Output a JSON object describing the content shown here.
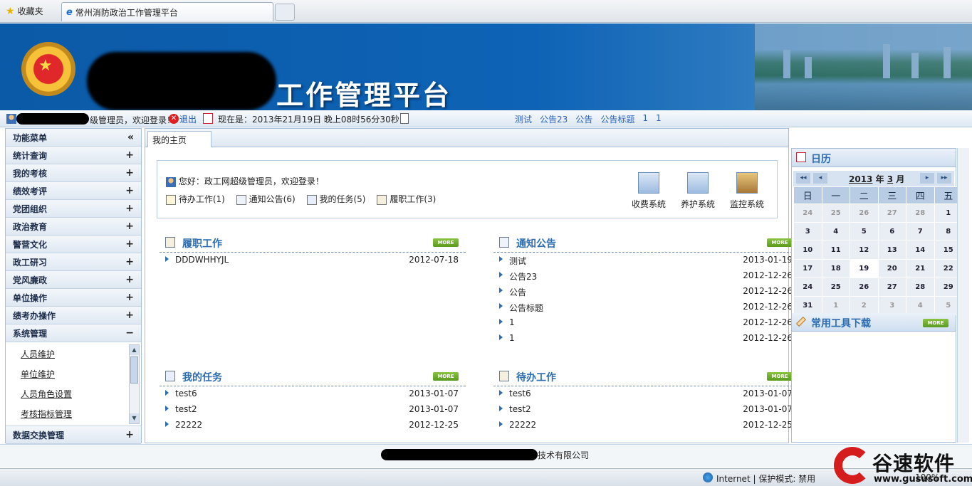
{
  "browser": {
    "favorites_label": "收藏夹",
    "tab_title": "常州消防政治工作管理平台",
    "status_zone": "Internet | 保护模式: 禁用",
    "zoom": "100%"
  },
  "banner": {
    "title": "工作管理平台"
  },
  "infobar": {
    "welcome": "级管理员，欢迎登录！",
    "logout": "退出",
    "now": "现在是：2013年21月19日 晚上08时56分30秒",
    "notices": [
      "测试",
      "公告23",
      "公告",
      "公告标题",
      "1",
      "1"
    ]
  },
  "sidebar": {
    "header": "功能菜单",
    "collapse": "«",
    "menus": [
      "统计查询",
      "我的考核",
      "绩效考评",
      "党团组织",
      "政治教育",
      "警营文化",
      "政工研习",
      "党风廉政",
      "单位操作",
      "绩考办操作"
    ],
    "expanded": "系统管理",
    "subitems": [
      "人员维护",
      "单位维护",
      "人员角色设置",
      "考核指标管理"
    ],
    "after": "数据交换管理"
  },
  "main": {
    "tab": "我的主页",
    "greeting": "您好：政工网超级管理员，欢迎登录！",
    "shortcuts": [
      "待办工作(1)",
      "通知公告(6)",
      "我的任务(5)",
      "履职工作(3)"
    ],
    "systems": [
      "收费系统",
      "养护系统",
      "监控系统"
    ],
    "more": "MORE",
    "panels": [
      {
        "title": "履职工作",
        "rows": [
          {
            "t": "DDDWHHYJL",
            "d": "2012-07-18"
          }
        ]
      },
      {
        "title": "通知公告",
        "rows": [
          {
            "t": "测试",
            "d": "2013-01-19"
          },
          {
            "t": "公告23",
            "d": "2012-12-26"
          },
          {
            "t": "公告",
            "d": "2012-12-26"
          },
          {
            "t": "公告标题",
            "d": "2012-12-26"
          },
          {
            "t": "1",
            "d": "2012-12-26"
          },
          {
            "t": "1",
            "d": "2012-12-26"
          }
        ]
      },
      {
        "title": "我的任务",
        "rows": [
          {
            "t": "test6",
            "d": "2013-01-07"
          },
          {
            "t": "test2",
            "d": "2013-01-07"
          },
          {
            "t": "22222",
            "d": "2012-12-25"
          }
        ]
      },
      {
        "title": "待办工作",
        "rows": [
          {
            "t": "test6",
            "d": "2013-01-07"
          },
          {
            "t": "test2",
            "d": "2013-01-07"
          },
          {
            "t": "22222",
            "d": "2012-12-25"
          }
        ]
      }
    ]
  },
  "calendar": {
    "title": "日历",
    "year": "2013",
    "year_label": "年",
    "month": "3",
    "month_label": "月",
    "weekdays": [
      "日",
      "一",
      "二",
      "三",
      "四",
      "五"
    ],
    "weeks": [
      [
        "24",
        "25",
        "26",
        "27",
        "28",
        "1"
      ],
      [
        "3",
        "4",
        "5",
        "6",
        "7",
        "8"
      ],
      [
        "10",
        "11",
        "12",
        "13",
        "14",
        "15"
      ],
      [
        "17",
        "18",
        "19",
        "20",
        "21",
        "22"
      ],
      [
        "24",
        "25",
        "26",
        "27",
        "28",
        "29"
      ],
      [
        "31",
        "1",
        "2",
        "3",
        "4",
        "5"
      ]
    ],
    "tools_title": "常用工具下载"
  },
  "footer": {
    "company": "技术有限公司"
  },
  "logo": {
    "text": "谷速软件",
    "url": "www.gususoft.com"
  }
}
